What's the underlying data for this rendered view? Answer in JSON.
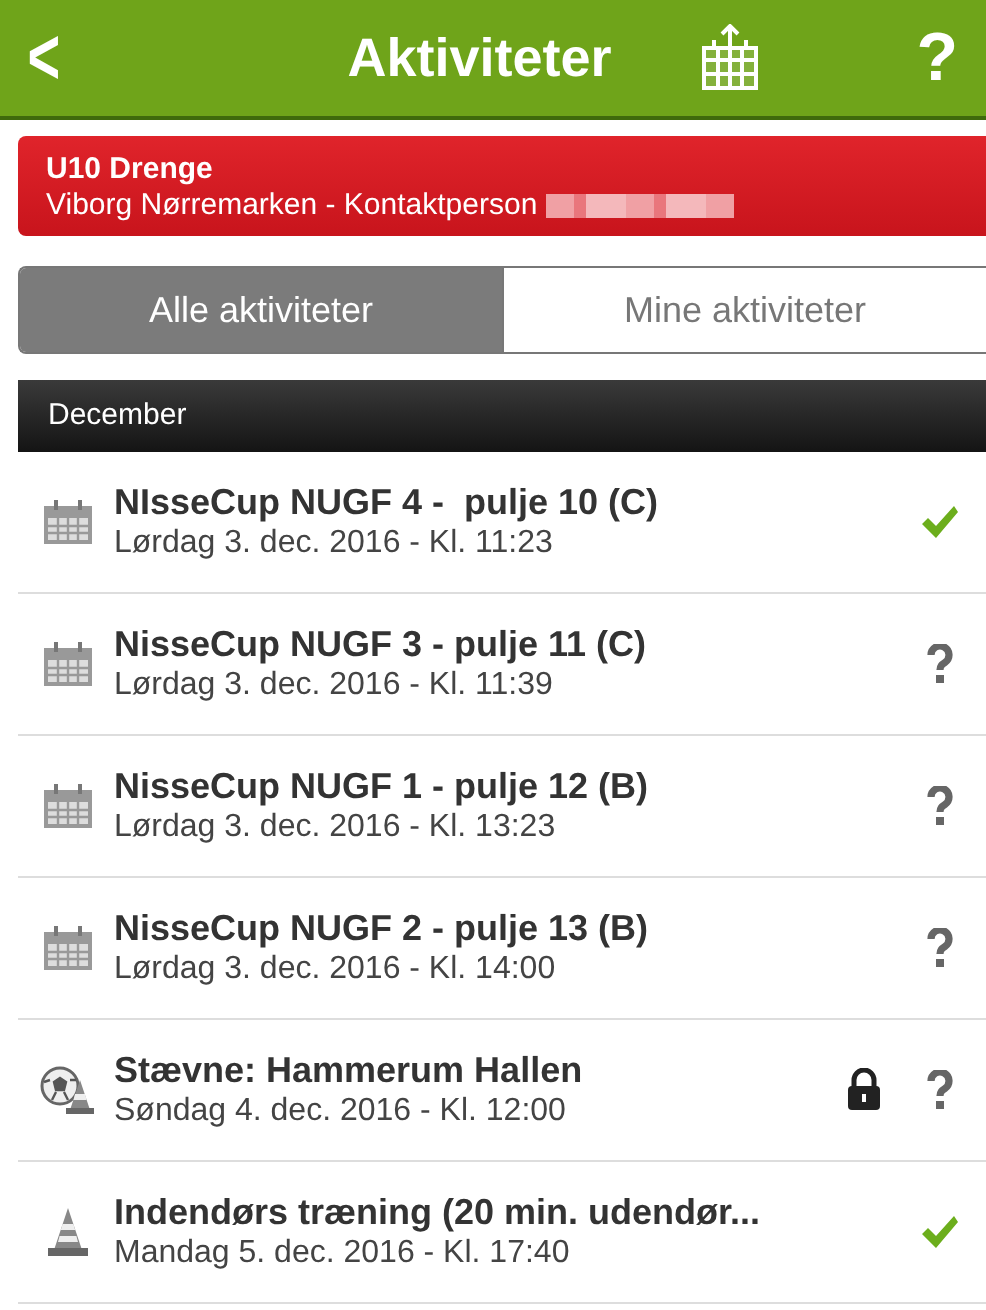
{
  "header": {
    "back": "<",
    "title": "Aktiviteter",
    "help": "?"
  },
  "team": {
    "name": "U10 Drenge",
    "detail": "Viborg Nørremarken - Kontaktperson"
  },
  "tabs": [
    {
      "label": "Alle aktiviteter",
      "selected": true
    },
    {
      "label": "Mine aktiviteter",
      "selected": false
    }
  ],
  "month": "December",
  "activities": [
    {
      "kind": "calendar",
      "title": "NIsseCup NUGF 4 -  pulje 10 (C)",
      "date": "Lørdag 3. dec. 2016 - Kl. 11:23",
      "accepted": true,
      "locked": false
    },
    {
      "kind": "calendar",
      "title": "NisseCup NUGF 3 - pulje 11 (C)",
      "date": "Lørdag 3. dec. 2016 - Kl. 11:39",
      "accepted": false,
      "locked": false
    },
    {
      "kind": "calendar",
      "title": "NisseCup NUGF 1 - pulje 12 (B)",
      "date": "Lørdag 3. dec. 2016 - Kl. 13:23",
      "accepted": false,
      "locked": false
    },
    {
      "kind": "calendar",
      "title": "NisseCup NUGF 2 - pulje 13 (B)",
      "date": "Lørdag 3. dec. 2016 - Kl. 14:00",
      "accepted": false,
      "locked": false
    },
    {
      "kind": "tournament",
      "title": "Stævne: Hammerum Hallen",
      "date": "Søndag 4. dec. 2016 - Kl. 12:00",
      "accepted": false,
      "locked": true
    },
    {
      "kind": "training",
      "title": "Indendørs træning (20 min. udendør...",
      "date": "Mandag 5. dec. 2016 - Kl. 17:40",
      "accepted": true,
      "locked": false
    }
  ]
}
